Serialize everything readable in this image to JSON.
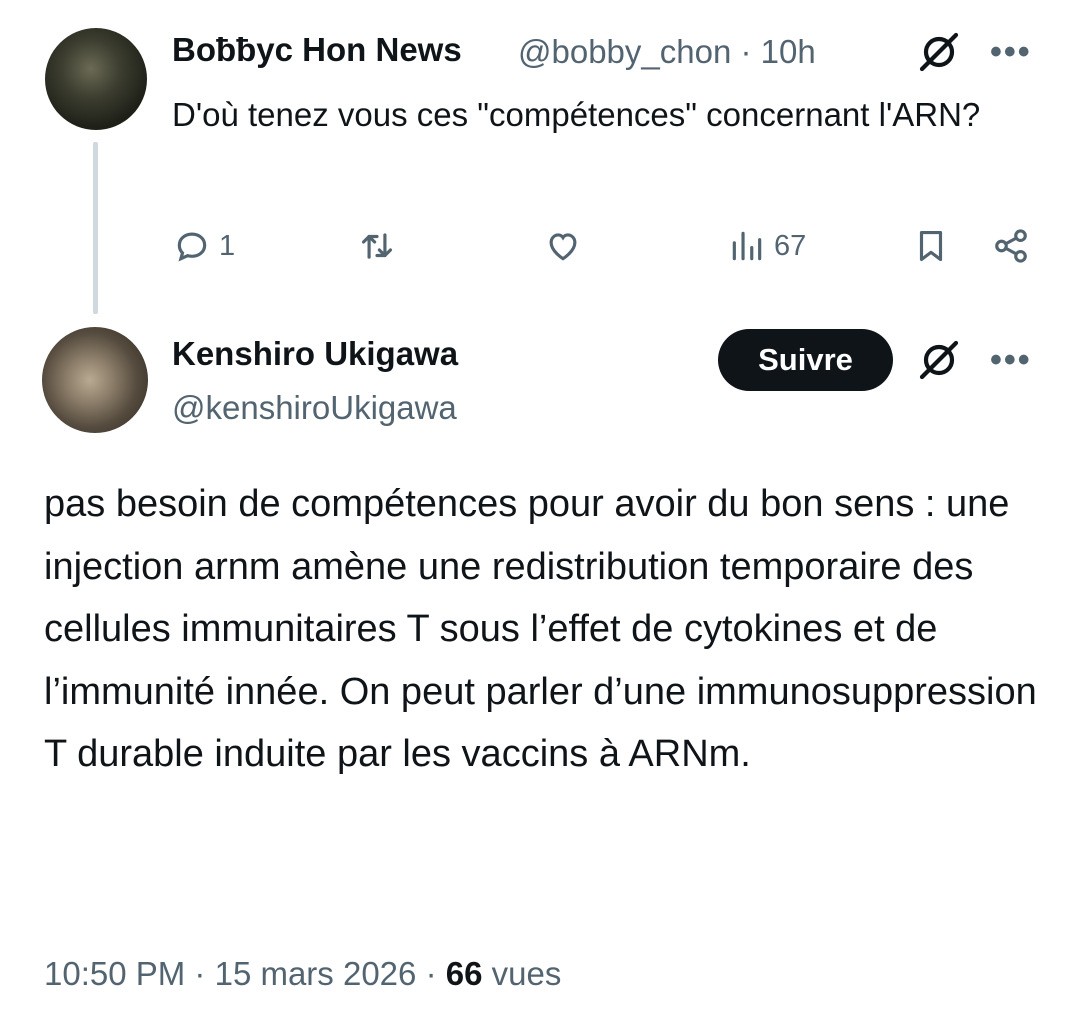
{
  "tweet1": {
    "author_name": "Boƀƀyc Hon News",
    "handle": "@bobby_chon",
    "separator": "·",
    "time": "10h",
    "text": "D'où tenez vous ces \"compétences\" concernant l'ARN?",
    "replies": "1",
    "views": "67"
  },
  "tweet2": {
    "author_name": "Kenshiro Ukigawa",
    "handle": "@kenshiroUkigawa",
    "follow_label": "Suivre",
    "text": "pas besoin de compétences pour avoir du bon sens : une injection arnm amène une redistribution temporaire des cellules immunitaires T sous l’effet de cytokines et de l’immunité innée. On peut parler d’une immunosuppression T durable induite par les vaccins à ARNm.",
    "time": "10:50 PM",
    "date": "15 mars 2026",
    "views_count": "66",
    "views_label": "vues"
  },
  "more_label": "•••",
  "icons": {
    "reply": "reply-icon",
    "retweet": "retweet-icon",
    "like": "heart-icon",
    "views": "views-icon",
    "bookmark": "bookmark-icon",
    "share": "share-icon",
    "grok": "grok-icon"
  }
}
